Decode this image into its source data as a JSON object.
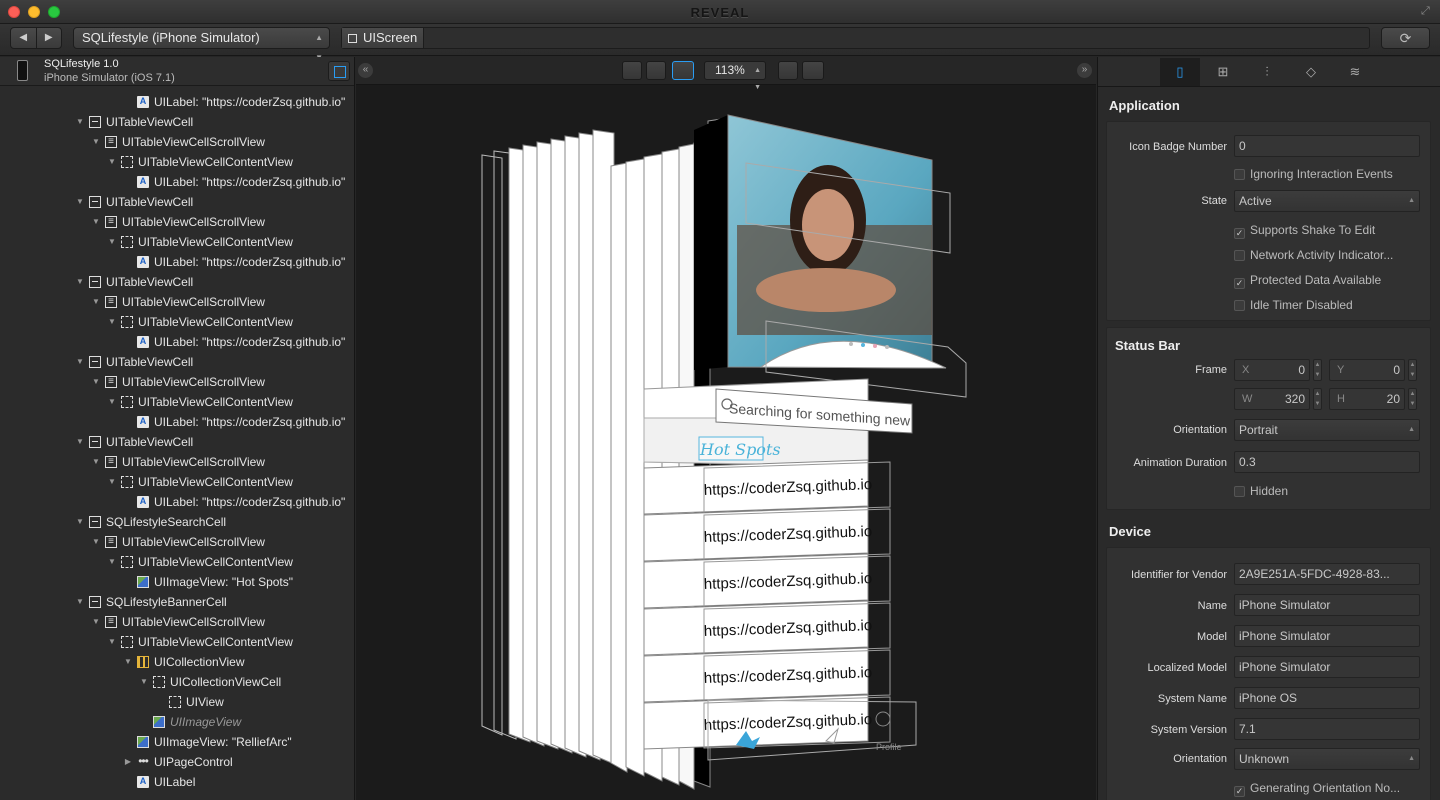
{
  "window": {
    "title": "REVEAL"
  },
  "toolbar": {
    "app_selector": "SQLifestyle (iPhone Simulator)",
    "breadcrumb": "UIScreen"
  },
  "left": {
    "app_name": "SQLifestyle 1.0",
    "device": "iPhone Simulator (iOS 7.1)",
    "tree": [
      {
        "depth": 4,
        "icon": "label",
        "tri": "",
        "text": "UILabel: \"https://coderZsq.github.io\""
      },
      {
        "depth": 1,
        "icon": "cell",
        "tri": "down",
        "text": "UITableViewCell"
      },
      {
        "depth": 2,
        "icon": "scroll",
        "tri": "down",
        "text": "UITableViewCellScrollView"
      },
      {
        "depth": 3,
        "icon": "content",
        "tri": "down",
        "text": "UITableViewCellContentView"
      },
      {
        "depth": 4,
        "icon": "label",
        "tri": "",
        "text": "UILabel: \"https://coderZsq.github.io\""
      },
      {
        "depth": 1,
        "icon": "cell",
        "tri": "down",
        "text": "UITableViewCell"
      },
      {
        "depth": 2,
        "icon": "scroll",
        "tri": "down",
        "text": "UITableViewCellScrollView"
      },
      {
        "depth": 3,
        "icon": "content",
        "tri": "down",
        "text": "UITableViewCellContentView"
      },
      {
        "depth": 4,
        "icon": "label",
        "tri": "",
        "text": "UILabel: \"https://coderZsq.github.io\""
      },
      {
        "depth": 1,
        "icon": "cell",
        "tri": "down",
        "text": "UITableViewCell"
      },
      {
        "depth": 2,
        "icon": "scroll",
        "tri": "down",
        "text": "UITableViewCellScrollView"
      },
      {
        "depth": 3,
        "icon": "content",
        "tri": "down",
        "text": "UITableViewCellContentView"
      },
      {
        "depth": 4,
        "icon": "label",
        "tri": "",
        "text": "UILabel: \"https://coderZsq.github.io\""
      },
      {
        "depth": 1,
        "icon": "cell",
        "tri": "down",
        "text": "UITableViewCell"
      },
      {
        "depth": 2,
        "icon": "scroll",
        "tri": "down",
        "text": "UITableViewCellScrollView"
      },
      {
        "depth": 3,
        "icon": "content",
        "tri": "down",
        "text": "UITableViewCellContentView"
      },
      {
        "depth": 4,
        "icon": "label",
        "tri": "",
        "text": "UILabel: \"https://coderZsq.github.io\""
      },
      {
        "depth": 1,
        "icon": "cell",
        "tri": "down",
        "text": "UITableViewCell"
      },
      {
        "depth": 2,
        "icon": "scroll",
        "tri": "down",
        "text": "UITableViewCellScrollView"
      },
      {
        "depth": 3,
        "icon": "content",
        "tri": "down",
        "text": "UITableViewCellContentView"
      },
      {
        "depth": 4,
        "icon": "label",
        "tri": "",
        "text": "UILabel: \"https://coderZsq.github.io\""
      },
      {
        "depth": 1,
        "icon": "cell",
        "tri": "down",
        "text": "SQLifestyleSearchCell"
      },
      {
        "depth": 2,
        "icon": "scroll",
        "tri": "down",
        "text": "UITableViewCellScrollView"
      },
      {
        "depth": 3,
        "icon": "content",
        "tri": "down",
        "text": "UITableViewCellContentView"
      },
      {
        "depth": 4,
        "icon": "image",
        "tri": "",
        "text": "UIImageView: \"Hot Spots\""
      },
      {
        "depth": 1,
        "icon": "cell",
        "tri": "down",
        "text": "SQLifestyleBannerCell"
      },
      {
        "depth": 2,
        "icon": "scroll",
        "tri": "down",
        "text": "UITableViewCellScrollView"
      },
      {
        "depth": 3,
        "icon": "content",
        "tri": "down",
        "text": "UITableViewCellContentView"
      },
      {
        "depth": 4,
        "icon": "collection",
        "tri": "down",
        "text": "UICollectionView"
      },
      {
        "depth": 5,
        "icon": "content",
        "tri": "down",
        "text": "UICollectionViewCell"
      },
      {
        "depth": 6,
        "icon": "content",
        "tri": "",
        "text": "UIView"
      },
      {
        "depth": 5,
        "icon": "image",
        "tri": "",
        "text": "UIImageView",
        "italic": true
      },
      {
        "depth": 4,
        "icon": "image",
        "tri": "",
        "text": "UIImageView: \"RelliefArc\""
      },
      {
        "depth": 4,
        "icon": "dots",
        "tri": "right",
        "text": "UIPageControl"
      },
      {
        "depth": 4,
        "icon": "label",
        "tri": "",
        "text": "UILabel"
      }
    ]
  },
  "canvas": {
    "zoom": "113%",
    "search_placeholder": "Searching for something new",
    "hot_spots": "Hot Spots",
    "row_text": "https://coderZsq.github.io",
    "profile_tab": "Profile"
  },
  "inspector": {
    "application": {
      "title": "Application",
      "badge_label": "Icon Badge Number",
      "badge_value": "0",
      "ignoring": "Ignoring Interaction Events",
      "state_label": "State",
      "state_value": "Active",
      "shake": "Supports Shake To Edit",
      "network": "Network Activity Indicator...",
      "protected": "Protected Data Available",
      "idle": "Idle Timer Disabled"
    },
    "status_bar": {
      "title": "Status Bar",
      "frame_label": "Frame",
      "x_key": "X",
      "x": "0",
      "y_key": "Y",
      "y": "0",
      "w_key": "W",
      "w": "320",
      "h_key": "H",
      "h": "20",
      "orientation_label": "Orientation",
      "orientation_value": "Portrait",
      "anim_label": "Animation Duration",
      "anim_value": "0.3",
      "hidden": "Hidden"
    },
    "device": {
      "title": "Device",
      "vendor_label": "Identifier for Vendor",
      "vendor_value": "2A9E251A-5FDC-4928-83...",
      "name_label": "Name",
      "name_value": "iPhone Simulator",
      "model_label": "Model",
      "model_value": "iPhone Simulator",
      "lmodel_label": "Localized Model",
      "lmodel_value": "iPhone Simulator",
      "sysname_label": "System Name",
      "sysname_value": "iPhone OS",
      "sysver_label": "System Version",
      "sysver_value": "7.1",
      "orient_label": "Orientation",
      "orient_value": "Unknown",
      "gen_orient": "Generating Orientation No..."
    },
    "checks": {
      "ignoring": false,
      "shake": true,
      "network": false,
      "protected": true,
      "idle": false,
      "hidden": false,
      "gen_orient": true
    }
  }
}
